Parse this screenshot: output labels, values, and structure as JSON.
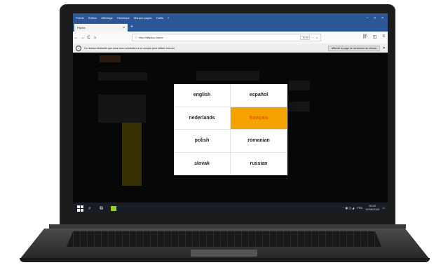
{
  "menubar": {
    "items": [
      "Fichier",
      "Édition",
      "Affichage",
      "Historique",
      "Marque-pages",
      "Outils",
      "?"
    ],
    "controls": [
      "–",
      "□",
      "×"
    ]
  },
  "tab": {
    "title": "Flybox",
    "close": "×",
    "new": "+"
  },
  "navbar": {
    "back": "←",
    "forward": "→",
    "reload": "C",
    "home": "⌂",
    "url": "http://Nflybox.frame",
    "zoom": "70 %",
    "more": "···",
    "star": "☆",
    "library": "|||\\",
    "sidebar": "◫",
    "menu": "≡"
  },
  "notice": {
    "icon": "i",
    "text": "Ce réseau nécessite que vous vous connectiez à un compte pour utiliser Internet.",
    "button": "Afficher la page de connexion du réseau",
    "close": "×"
  },
  "language_picker": {
    "languages": [
      {
        "label": "english"
      },
      {
        "label": "español"
      },
      {
        "label": "nederlands"
      },
      {
        "label": "français",
        "selected": true
      },
      {
        "label": "polish"
      },
      {
        "label": "romanian"
      },
      {
        "label": "slovak"
      },
      {
        "label": "russian"
      }
    ],
    "selected_color": "#f5a300",
    "selected_text_color": "#ff4a00"
  },
  "taskbar": {
    "search_icon": "⌕",
    "taskview_icon": "⧉",
    "tray_text": "FRA",
    "time": "00:02",
    "date": "16/08/2020"
  }
}
